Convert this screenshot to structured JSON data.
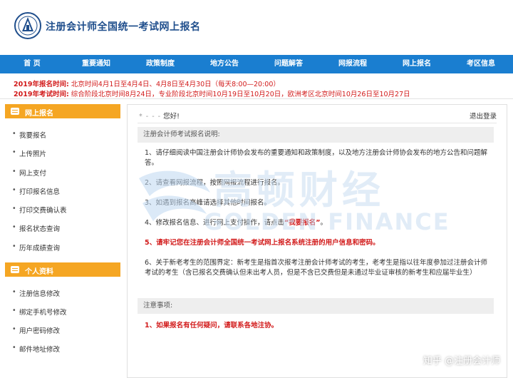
{
  "header": {
    "title": "注册会计师全国统一考试网上报名"
  },
  "nav": {
    "items": [
      "首 页",
      "重要通知",
      "政策制度",
      "地方公告",
      "问题解答",
      "网报流程",
      "网上报名",
      "考区信息"
    ]
  },
  "notice": {
    "line1_label": "2019年报名时间:",
    "line1_text": "北京时间4月1日至4月4日、4月8日至4月30日（每天8:00—20:00）",
    "line2_label": "2019年考试时间:",
    "line2_text": "综合阶段北京时间8月24日，专业阶段北京时间10月19日至10月20日，欧洲考区北京时间10月26日至10月27日"
  },
  "sidebar": {
    "section1_title": "网上报名",
    "section1_items": [
      "我要报名",
      "上传照片",
      "网上支付",
      "打印报名信息",
      "打印交费确认表",
      "报名状态查询",
      "历年成绩查询"
    ],
    "section2_title": "个人资料",
    "section2_items": [
      "注册信息修改",
      "绑定手机号修改",
      "用户密码修改",
      "邮件地址修改"
    ]
  },
  "main": {
    "greeting_name": "* - - -",
    "greeting_suffix": "您好!",
    "logout": "退出登录",
    "instructions_title": "注册会计师考试报名说明:",
    "p1": "1、请仔细阅读中国注册会计师协会发布的重要通知和政策制度，以及地方注册会计师协会发布的地方公告和问题解答。",
    "p2": "2、请查看网报流程，按照网报流程进行报名。",
    "p3": "3、如遇到报名高峰请选择其他时间报名。",
    "p4_prefix": "4、修改报名信息、进行网上支付操作，请点击",
    "p4_link": "“我要报名”",
    "p4_suffix": "。",
    "p5": "5、请牢记您在注册会计师全国统一考试网上报名系统注册的用户信息和密码。",
    "p6": "6、关于新老考生的范围界定：新考生是指首次报考注册会计师考试的考生，老考生是指以往年度参加过注册会计师考试的考生（含已报名交费确认但未出考人员，但是不含已交费但是未通过毕业证审核的新考生和应届毕业生）",
    "notes_title": "注意事项:",
    "note1": "1、如果报名有任何疑问，请联系各地注协。"
  },
  "watermark": {
    "cn": "高顿财经",
    "en": "GOLDEN FINANCE"
  },
  "credit": "知乎 @注册会计师",
  "colors": {
    "nav": "#1a7ed0",
    "sidebar_header": "#f5a623",
    "alert": "#d21b1b",
    "title": "#1f4e8c"
  }
}
